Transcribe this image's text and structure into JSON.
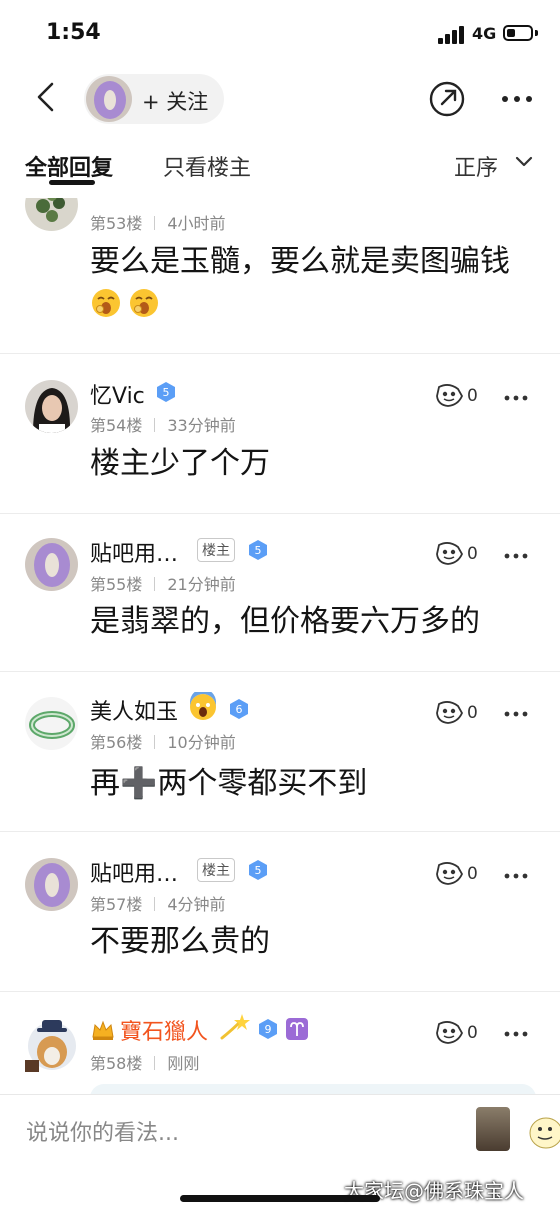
{
  "status_bar": {
    "time": "1:54",
    "network": "4G"
  },
  "nav": {
    "follow_label": "+ 关注"
  },
  "tabs": {
    "all": "全部回复",
    "host_only": "只看楼主",
    "sort": "正序"
  },
  "colors": {
    "level_badge": "#5b9ef6",
    "vip_name": "#f2541e",
    "divider": "#ececec"
  },
  "posts": [
    {
      "username": "",
      "floor": "第53楼",
      "time": "4小时前",
      "content": "要么是玉髓，要么就是卖图骗钱",
      "emoji": "yawn-emoji"
    },
    {
      "username": "忆Vic",
      "level": "5",
      "floor": "第54楼",
      "time": "33分钟前",
      "content": "楼主少了个万",
      "likes": "0"
    },
    {
      "username": "贴吧用…",
      "host_badge": "楼主",
      "level": "5",
      "floor": "第55楼",
      "time": "21分钟前",
      "content": "是翡翠的，但价格要六万多的",
      "likes": "0"
    },
    {
      "username": "美人如玉",
      "name_emoji": "scream-emoji",
      "level": "6",
      "floor": "第56楼",
      "time": "10分钟前",
      "content": "再➕两个零都买不到",
      "likes": "0"
    },
    {
      "username": "贴吧用…",
      "host_badge": "楼主",
      "level": "5",
      "floor": "第57楼",
      "time": "4分钟前",
      "content": "不要那么贵的",
      "likes": "0"
    },
    {
      "username": "寶石獵人",
      "level": "9",
      "floor": "第58楼",
      "time": "刚刚",
      "likes": "0"
    }
  ],
  "reply_bar": {
    "placeholder": "说说你的看法...",
    "watermark": "大家坛@佛系珠宝人"
  }
}
